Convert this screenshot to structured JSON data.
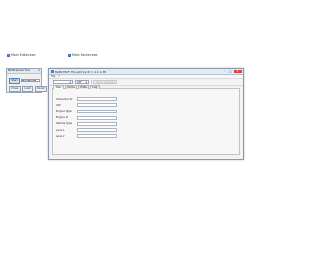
{
  "desktop": {
    "links": [
      {
        "label": "Main Editor.exe"
      },
      {
        "label": "Main Server.exe"
      }
    ]
  },
  "mini_window": {
    "title": "MAIN Server Tool",
    "close_glyph": "✕",
    "start_label": "Start",
    "progress_fraction": 0.82,
    "buttons": [
      "Close",
      "Load",
      "About"
    ]
  },
  "main_window": {
    "title": "MAIN EDIT: File edit by ID = 1.1.1.38",
    "controls": {
      "minimize": "–",
      "maximize": "□",
      "close": "✕"
    },
    "menu": [
      "File",
      "?"
    ],
    "toolbar": {
      "combo_left": "",
      "combo_right": "GFF",
      "disabled_button": "Apply changes"
    },
    "tabs": [
      "Main",
      "Items",
      "Edits",
      "Log"
    ],
    "active_tab": 0,
    "form_fields": [
      {
        "label": "Character ID",
        "value": ""
      },
      {
        "label": "UID",
        "value": ""
      },
      {
        "label": "Engine Type",
        "value": ""
      },
      {
        "label": "Engine #",
        "value": ""
      },
      {
        "label": "Vehicle Type",
        "value": ""
      },
      {
        "label": "Lenz 1",
        "value": ""
      },
      {
        "label": "Lenz 2",
        "value": ""
      }
    ]
  },
  "colors": {
    "title_bar": "#e1ebf6",
    "close_button": "#d9473b",
    "accent": "#4d84c7"
  }
}
